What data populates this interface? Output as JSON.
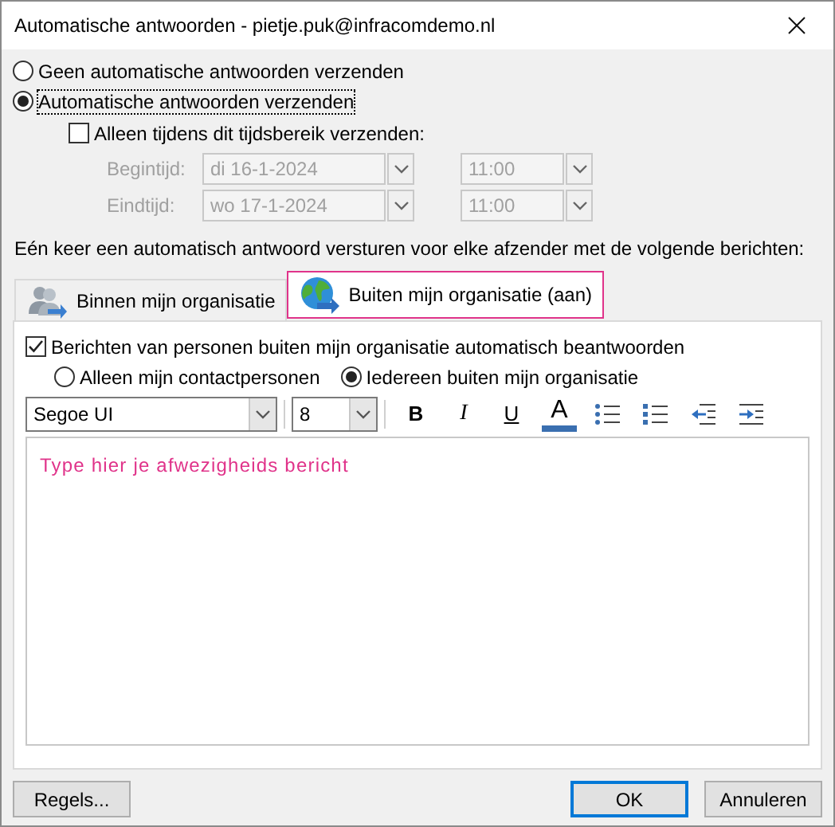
{
  "window": {
    "title": "Automatische antwoorden - pietje.puk@infracomdemo.nl"
  },
  "modes": [
    {
      "label": "Geen automatische antwoorden verzenden",
      "selected": false
    },
    {
      "label": "Automatische antwoorden verzenden",
      "selected": true
    }
  ],
  "time_range": {
    "label": "Alleen tijdens dit tijdsbereik verzenden:",
    "checked": false,
    "disabled": true,
    "rows": [
      {
        "label": "Begintijd:",
        "date": "di 16-1-2024",
        "time": "11:00"
      },
      {
        "label": "Eindtijd:",
        "date": "wo 17-1-2024",
        "time": "11:00"
      }
    ]
  },
  "intro": "Eén keer een automatisch antwoord versturen voor elke afzender met de volgende berichten:",
  "tabs": [
    {
      "label": "Binnen mijn organisatie",
      "kind": "people",
      "selected": false
    },
    {
      "label": "Buiten mijn organisatie (aan)",
      "kind": "globe",
      "selected": true
    }
  ],
  "outside": {
    "reply_label": "Berichten van personen buiten mijn organisatie automatisch beantwoorden",
    "checked": true,
    "audience": [
      {
        "label": "Alleen mijn contactpersonen",
        "selected": false
      },
      {
        "label": "Iedereen buiten mijn organisatie",
        "selected": true
      }
    ]
  },
  "toolbar": {
    "font": "Segoe UI",
    "size": "8",
    "tools": [
      {
        "kind": "bold",
        "label": "B"
      },
      {
        "kind": "italic",
        "label": "I"
      },
      {
        "kind": "underline",
        "label": "U"
      },
      {
        "kind": "font-color",
        "label": "A"
      },
      {
        "kind": "bullets"
      },
      {
        "kind": "numbering"
      },
      {
        "kind": "outdent"
      },
      {
        "kind": "indent"
      }
    ]
  },
  "message": {
    "text": "Type hier je afwezigheids bericht"
  },
  "buttons": [
    {
      "kind": "rules",
      "label": "Regels..."
    },
    {
      "kind": "default",
      "label": "OK"
    },
    {
      "kind": "cancel",
      "label": "Annuleren"
    }
  ]
}
